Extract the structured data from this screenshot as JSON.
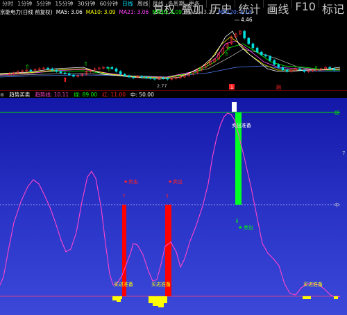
{
  "tabs": [
    "分时",
    "1分钟",
    "5分钟",
    "15分钟",
    "30分钟",
    "60分钟",
    "日线",
    "周线",
    "月线",
    "多周期",
    "更多"
  ],
  "active_tab": "日线",
  "right_buttons": [
    "复权",
    "叠加",
    "历史",
    "统计",
    "画线",
    "F10",
    "标记"
  ],
  "stock_title": "京能电力(日线 前复权)",
  "ma": [
    {
      "label": "MA5: 3.06",
      "color": "#ffffff"
    },
    {
      "label": "MA10: 3.09",
      "color": "#ffff00"
    },
    {
      "label": "MA21: 3.06",
      "color": "#ff44ff"
    },
    {
      "label": "MA30: 3.09",
      "color": "#00ff00"
    },
    {
      "label": "MA60: 3.23",
      "color": "#aaaaaa"
    },
    {
      "label": "MA120: 3.13",
      "color": "#5080ff"
    }
  ],
  "price_high": "4.46",
  "price_low": "2.77",
  "bottom_badges": [
    "1",
    "融"
  ],
  "indicator": {
    "name": "趋势买卖",
    "line_label": "趋势线: 10.11",
    "green_label": "绿: 89.00",
    "red_label": "红: 11.00",
    "mid_label": "中: 50.00",
    "right_top": "超",
    "right_mid": "中",
    "right_7": "7"
  },
  "signals": {
    "sell_prep": "卖出准备",
    "sell": "卖出",
    "buy_prep": "买进准备",
    "buy": "买入",
    "short_sell": "卖出"
  },
  "colors": {
    "accent": "#00e5ff",
    "up": "#ff2222",
    "down": "#00ff00",
    "line": "#ff44cc",
    "gold": "#ffff00"
  }
}
